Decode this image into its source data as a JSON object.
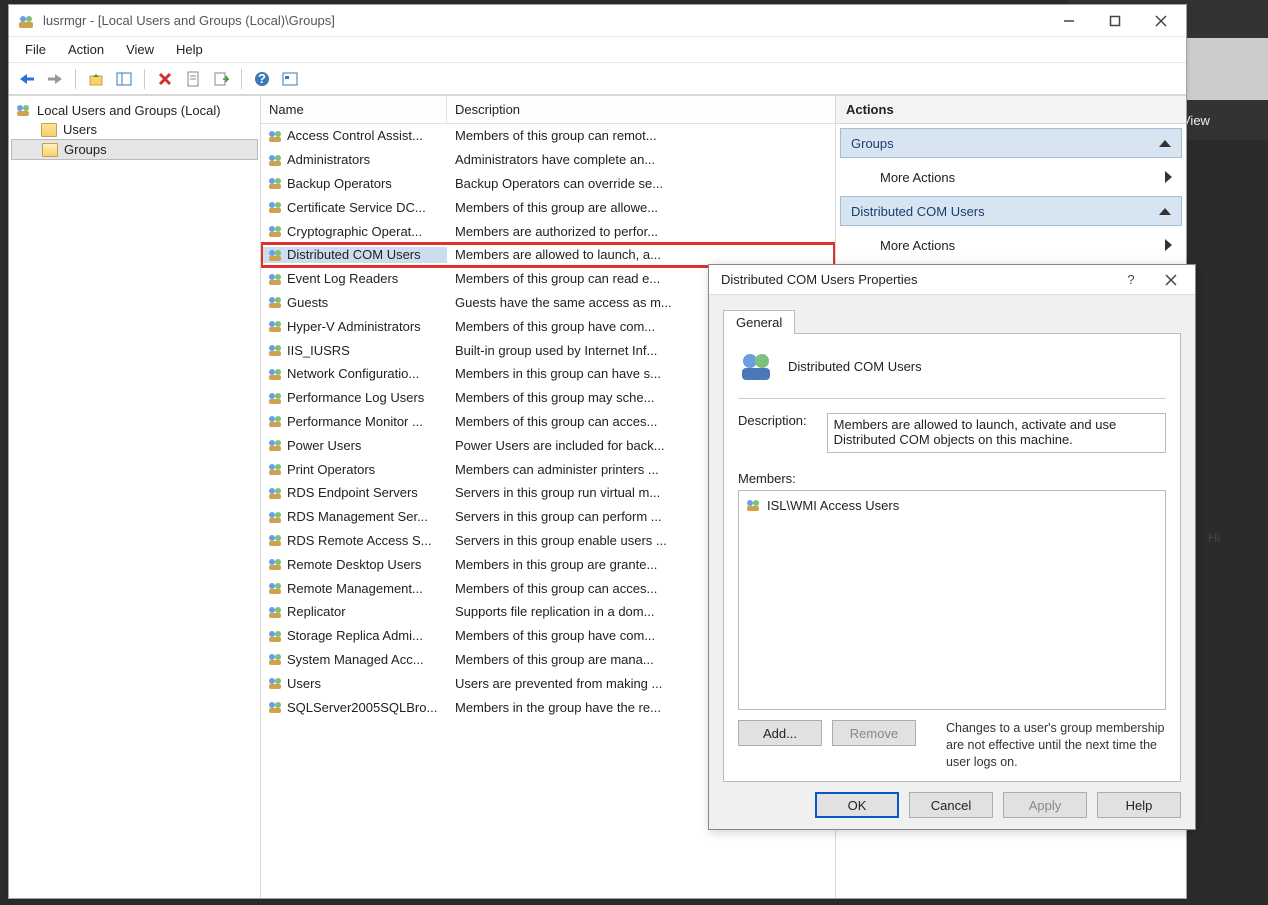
{
  "bg": {
    "view": "View",
    "hide": "Hi"
  },
  "window": {
    "title": "lusrmgr - [Local Users and Groups (Local)\\Groups]",
    "menus": [
      "File",
      "Action",
      "View",
      "Help"
    ]
  },
  "tree": {
    "root": "Local Users and Groups (Local)",
    "children": [
      {
        "label": "Users",
        "selected": false
      },
      {
        "label": "Groups",
        "selected": true
      }
    ]
  },
  "list": {
    "columns": {
      "name": "Name",
      "desc": "Description"
    },
    "rows": [
      {
        "name": "Access Control Assist...",
        "desc": "Members of this group can remot...",
        "hl": false
      },
      {
        "name": "Administrators",
        "desc": "Administrators have complete an...",
        "hl": false
      },
      {
        "name": "Backup Operators",
        "desc": "Backup Operators can override se...",
        "hl": false
      },
      {
        "name": "Certificate Service DC...",
        "desc": "Members of this group are allowe...",
        "hl": false
      },
      {
        "name": "Cryptographic Operat...",
        "desc": "Members are authorized to perfor...",
        "hl": false
      },
      {
        "name": "Distributed COM Users",
        "desc": "Members are allowed to launch, a...",
        "hl": true
      },
      {
        "name": "Event Log Readers",
        "desc": "Members of this group can read e...",
        "hl": false
      },
      {
        "name": "Guests",
        "desc": "Guests have the same access as m...",
        "hl": false
      },
      {
        "name": "Hyper-V Administrators",
        "desc": "Members of this group have com...",
        "hl": false
      },
      {
        "name": "IIS_IUSRS",
        "desc": "Built-in group used by Internet Inf...",
        "hl": false
      },
      {
        "name": "Network Configuratio...",
        "desc": "Members in this group can have s...",
        "hl": false
      },
      {
        "name": "Performance Log Users",
        "desc": "Members of this group may sche...",
        "hl": false
      },
      {
        "name": "Performance Monitor ...",
        "desc": "Members of this group can acces...",
        "hl": false
      },
      {
        "name": "Power Users",
        "desc": "Power Users are included for back...",
        "hl": false
      },
      {
        "name": "Print Operators",
        "desc": "Members can administer printers ...",
        "hl": false
      },
      {
        "name": "RDS Endpoint Servers",
        "desc": "Servers in this group run virtual m...",
        "hl": false
      },
      {
        "name": "RDS Management Ser...",
        "desc": "Servers in this group can perform ...",
        "hl": false
      },
      {
        "name": "RDS Remote Access S...",
        "desc": "Servers in this group enable users ...",
        "hl": false
      },
      {
        "name": "Remote Desktop Users",
        "desc": "Members in this group are grante...",
        "hl": false
      },
      {
        "name": "Remote Management...",
        "desc": "Members of this group can acces...",
        "hl": false
      },
      {
        "name": "Replicator",
        "desc": "Supports file replication in a dom...",
        "hl": false
      },
      {
        "name": "Storage Replica Admi...",
        "desc": "Members of this group have com...",
        "hl": false
      },
      {
        "name": "System Managed Acc...",
        "desc": "Members of this group are mana...",
        "hl": false
      },
      {
        "name": "Users",
        "desc": "Users are prevented from making ...",
        "hl": false
      },
      {
        "name": "SQLServer2005SQLBro...",
        "desc": "Members in the group have the re...",
        "hl": false
      }
    ]
  },
  "actions": {
    "title": "Actions",
    "section1": "Groups",
    "section2": "Distributed COM Users",
    "more": "More Actions"
  },
  "dialog": {
    "title": "Distributed COM Users Properties",
    "tab": "General",
    "name": "Distributed COM Users",
    "descLabel": "Description:",
    "desc": "Members are allowed to launch, activate and use Distributed COM objects on this machine.",
    "membersLabel": "Members:",
    "members": [
      "ISL\\WMI Access Users"
    ],
    "add": "Add...",
    "remove": "Remove",
    "note": "Changes to a user's group membership are not effective until the next time the user logs on.",
    "ok": "OK",
    "cancel": "Cancel",
    "apply": "Apply",
    "help": "Help"
  }
}
